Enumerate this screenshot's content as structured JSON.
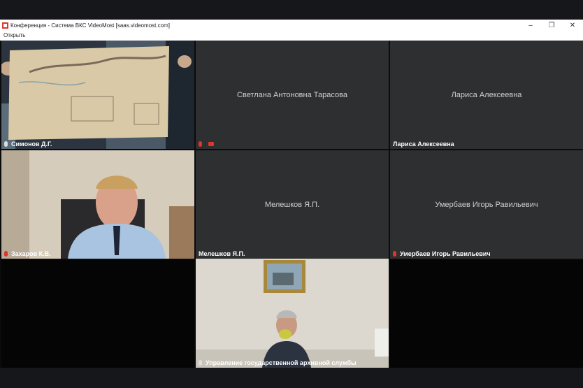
{
  "window": {
    "title": "Конференция - Система ВКС VideoMost [saas.videomost.com]",
    "minimize": "–",
    "restore": "❐",
    "close": "✕"
  },
  "menu": {
    "open": "Открыть"
  },
  "tiles": [
    {
      "label": "Симонов Д.Г.",
      "mic": "on"
    },
    {
      "name": "Светлана Антоновна Тарасова",
      "label": "",
      "mic": "muted",
      "camera": "off"
    },
    {
      "name": "Лариса Алексеевна",
      "label": "Лариса Алексеевна"
    },
    {
      "label": "Захаров К.В.",
      "mic": "muted"
    },
    {
      "name": "Мелешков Я.П.",
      "label": "Мелешков Я.П."
    },
    {
      "name": "Умербаев Игорь Равильевич",
      "label": "Умербаев Игорь Равильевич",
      "mic": "muted"
    },
    {
      "label": ""
    },
    {
      "label": "Управление государственной архивной службы",
      "mic": "on",
      "active": true
    },
    {
      "label": ""
    }
  ],
  "colors": {
    "accent": "#e0332b",
    "active_border": "#e0452c"
  }
}
